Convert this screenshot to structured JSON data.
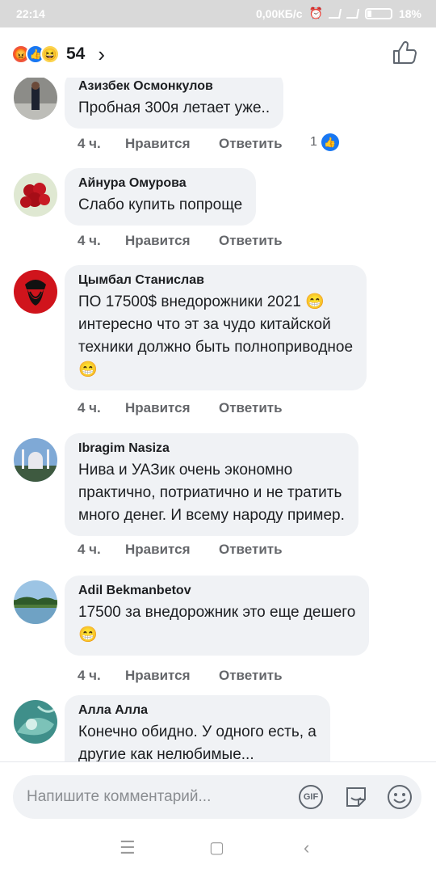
{
  "status_bar": {
    "time": "22:14",
    "network_speed": "0,00КБ/с",
    "battery": "18%"
  },
  "header": {
    "reaction_count": "54",
    "reactions": [
      "angry-reaction",
      "like-reaction",
      "haha-reaction"
    ]
  },
  "comments": [
    {
      "author": "Азизбек Осмонкулов",
      "text": "Пробная 300я летает уже..",
      "time": "4 ч.",
      "like_label": "Нравится",
      "reply_label": "Ответить",
      "likes": "1"
    },
    {
      "author": "Айнура Омурова",
      "text": "Слабо купить попроще",
      "time": "4 ч.",
      "like_label": "Нравится",
      "reply_label": "Ответить"
    },
    {
      "author": "Цымбал Станислав",
      "text": "ПО 17500$ внедорожники 2021 😁\nинтересно что эт за чудо китайской\nтехники должно быть полноприводное\n😁",
      "time": "4 ч.",
      "like_label": "Нравится",
      "reply_label": "Ответить"
    },
    {
      "author": "Ibragim Nasiza",
      "text": "Нива и УАЗик очень экономно\nпрактично, потриатично и не тратить\nмного денег. И всему народу пример.",
      "time": "4 ч.",
      "like_label": "Нравится",
      "reply_label": "Ответить"
    },
    {
      "author": "Adil Bekmanbetov",
      "text": "17500 за внедорожник это еще дешего\n😁",
      "time": "4 ч.",
      "like_label": "Нравится",
      "reply_label": "Ответить"
    },
    {
      "author": "Алла Алла",
      "text": "Конечно обидно. У одного есть, а\nдругие как нелюбимые...",
      "time": "",
      "like_label": "",
      "reply_label": ""
    }
  ],
  "composer": {
    "placeholder": "Напишите комментарий...",
    "gif_label": "GIF"
  }
}
